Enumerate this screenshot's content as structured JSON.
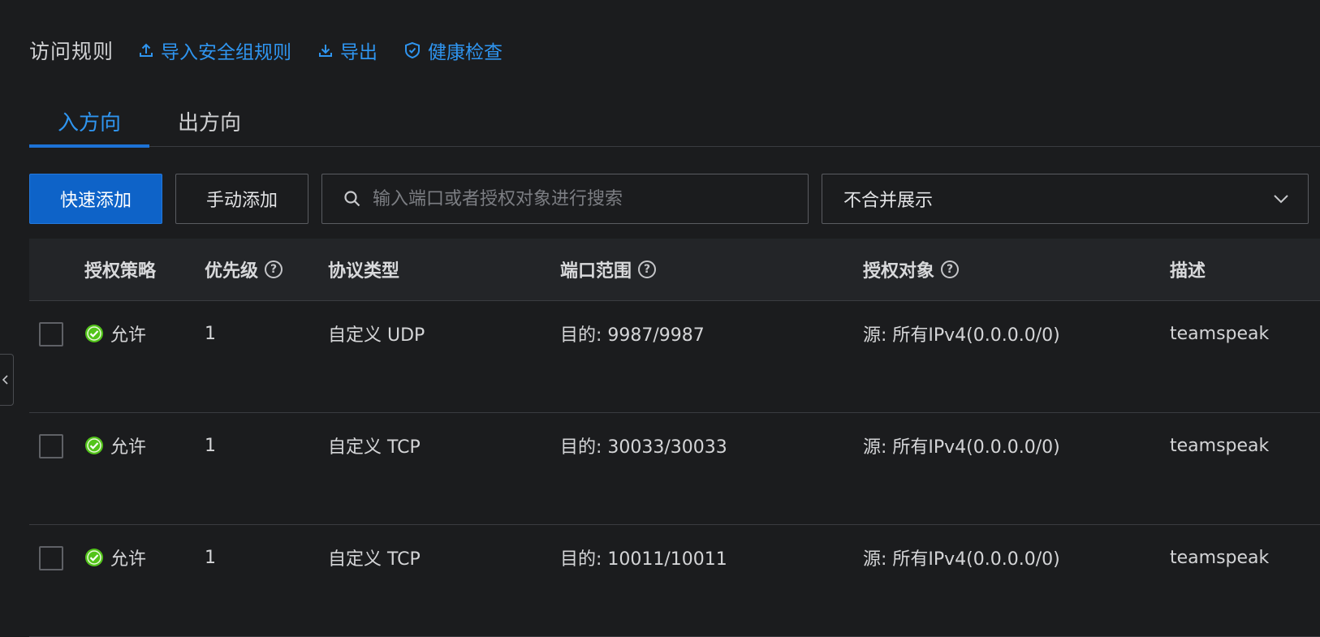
{
  "header": {
    "title": "访问规则",
    "links": {
      "import": "导入安全组规则",
      "export": "导出",
      "health": "健康检查"
    }
  },
  "tabs": {
    "inbound": "入方向",
    "outbound": "出方向",
    "active": "inbound"
  },
  "actions": {
    "quick_add": "快速添加",
    "manual_add": "手动添加",
    "search_placeholder": "输入端口或者授权对象进行搜索",
    "merge_select_value": "不合并展示"
  },
  "table": {
    "headers": {
      "policy": "授权策略",
      "priority": "优先级",
      "protocol": "协议类型",
      "port": "端口范围",
      "source": "授权对象",
      "description": "描述"
    },
    "help_glyph": "?",
    "rows": [
      {
        "policy": "允许",
        "priority": "1",
        "protocol": "自定义 UDP",
        "port": "目的: 9987/9987",
        "source": "源: 所有IPv4(0.0.0.0/0)",
        "description": "teamspeak"
      },
      {
        "policy": "允许",
        "priority": "1",
        "protocol": "自定义 TCP",
        "port": "目的: 30033/30033",
        "source": "源: 所有IPv4(0.0.0.0/0)",
        "description": "teamspeak"
      },
      {
        "policy": "允许",
        "priority": "1",
        "protocol": "自定义 TCP",
        "port": "目的: 10011/10011",
        "source": "源: 所有IPv4(0.0.0.0/0)",
        "description": "teamspeak"
      }
    ]
  },
  "colors": {
    "accent": "#2f95f0",
    "primary_button": "#0e63c8",
    "allow_icon": "#52c41a",
    "background": "#1b1c1e"
  },
  "icons": {
    "import": "upload-icon",
    "export": "download-icon",
    "health": "shield-check-icon",
    "search": "search-icon",
    "select": "chevron-down-icon",
    "allow": "check-circle-icon",
    "collapse": "chevron-left-icon"
  }
}
